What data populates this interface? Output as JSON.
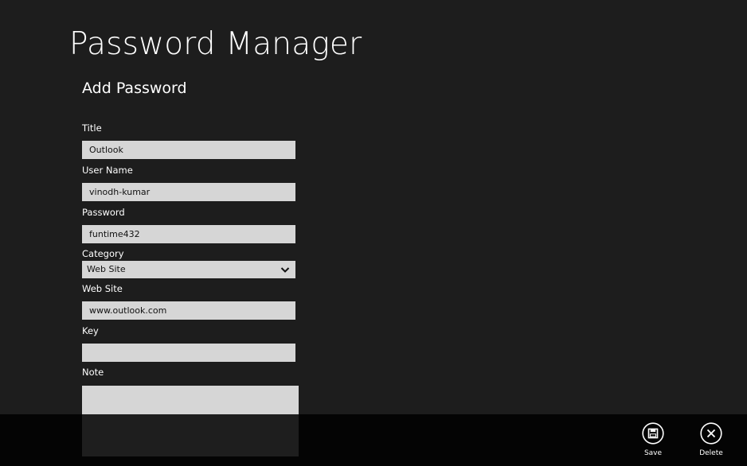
{
  "app": {
    "title": "Password Manager"
  },
  "page": {
    "title": "Add Password"
  },
  "form": {
    "title_label": "Title",
    "title_value": "Outlook",
    "username_label": "User Name",
    "username_value": "vinodh-kumar",
    "password_label": "Password",
    "password_value": "funtime432",
    "category_label": "Category",
    "category_value": "Web Site",
    "website_label": "Web Site",
    "website_value": "www.outlook.com",
    "key_label": "Key",
    "key_value": "",
    "note_label": "Note",
    "note_value": ""
  },
  "app_bar": {
    "save_label": "Save",
    "save_icon": "save-icon",
    "delete_label": "Delete",
    "delete_icon": "close-icon"
  },
  "colors": {
    "background": "#1d1d1d",
    "field": "#d6d6d6",
    "app_bar": "#000000"
  }
}
